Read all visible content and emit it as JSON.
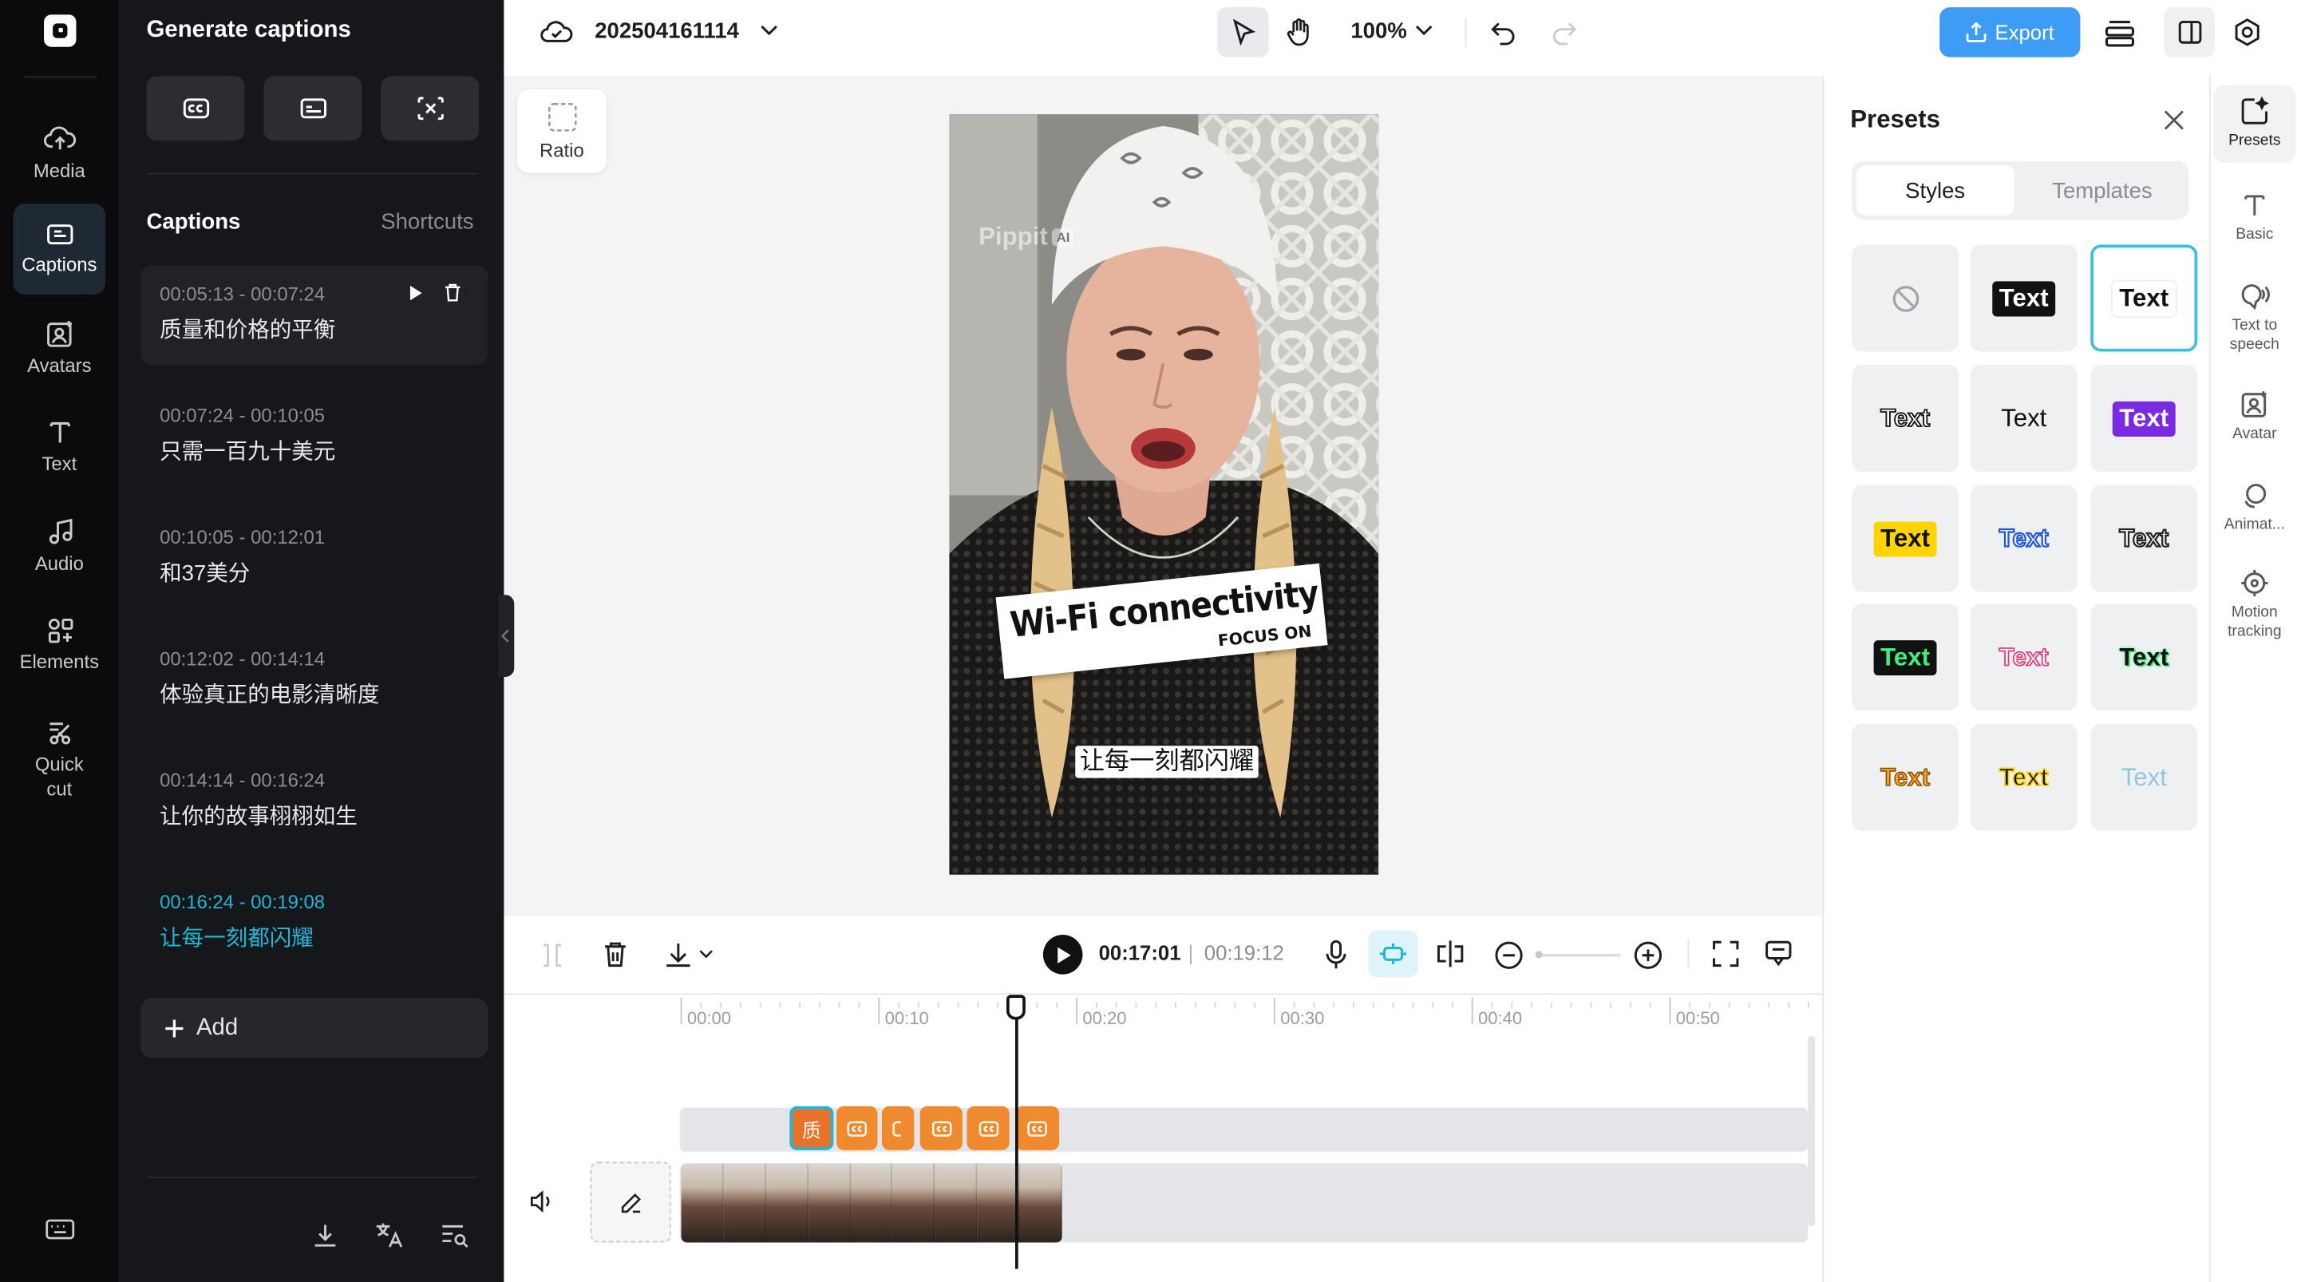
{
  "rail": {
    "items": [
      {
        "label": "Media",
        "icon": "cloud-upload-icon"
      },
      {
        "label": "Captions",
        "icon": "captions-icon"
      },
      {
        "label": "Avatars",
        "icon": "avatar-icon"
      },
      {
        "label": "Text",
        "icon": "text-icon"
      },
      {
        "label": "Audio",
        "icon": "music-icon"
      },
      {
        "label": "Elements",
        "icon": "elements-icon"
      },
      {
        "label": "Quick cut",
        "icon": "scissors-icon"
      }
    ],
    "active": "Captions"
  },
  "panel": {
    "title": "Generate captions",
    "captions_heading": "Captions",
    "shortcuts": "Shortcuts",
    "captions": [
      {
        "time": "00:05:13 - 00:07:24",
        "text": "质量和价格的平衡"
      },
      {
        "time": "00:07:24 - 00:10:05",
        "text": "只需一百九十美元"
      },
      {
        "time": "00:10:05 - 00:12:01",
        "text": "和37美分"
      },
      {
        "time": "00:12:02 - 00:14:14",
        "text": "体验真正的电影清晰度"
      },
      {
        "time": "00:14:14 - 00:16:24",
        "text": "让你的故事栩栩如生"
      },
      {
        "time": "00:16:24 - 00:19:08",
        "text": "让每一刻都闪耀"
      }
    ],
    "add_label": "Add"
  },
  "topbar": {
    "project_name": "202504161114",
    "zoom": "100%",
    "export_label": "Export"
  },
  "canvas": {
    "ratio_label": "Ratio",
    "watermark": "Pippit",
    "watermark_badge": "AI",
    "sticker_main": "Wi-Fi connectivity",
    "sticker_sub": "FOCUS ON",
    "subtitle": "让每一刻都闪耀"
  },
  "timeline": {
    "current_time": "00:17:01",
    "total_time": "00:19:12",
    "ticks": [
      "00:00",
      "00:10",
      "00:20",
      "00:30",
      "00:40",
      "00:50"
    ],
    "caption_chip_text": "质"
  },
  "presets": {
    "title": "Presets",
    "tabs": [
      "Styles",
      "Templates"
    ],
    "sample": "Text"
  },
  "right_rail": {
    "items": [
      "Presets",
      "Basic",
      "Text to speech",
      "Avatar",
      "Animat...",
      "Motion tracking"
    ]
  },
  "colors": {
    "accent": "#1fb6d8",
    "export": "#3e9cf6",
    "chip": "#f08a2e"
  }
}
